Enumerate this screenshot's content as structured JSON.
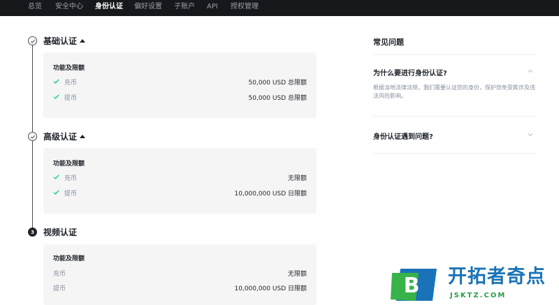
{
  "nav": {
    "items": [
      {
        "label": "总览"
      },
      {
        "label": "安全中心"
      },
      {
        "label": "身份认证"
      },
      {
        "label": "偏好设置"
      },
      {
        "label": "子账户"
      },
      {
        "label": "API"
      },
      {
        "label": "授权管理"
      }
    ],
    "active_index": 2
  },
  "steps": [
    {
      "title": "基础认证",
      "status": "done",
      "expanded": true,
      "card_heading": "功能及限额",
      "rows": [
        {
          "label": "充币",
          "value": "50,000 USD 总限额",
          "checked": true
        },
        {
          "label": "提币",
          "value": "50,000 USD 总限额",
          "checked": true
        }
      ]
    },
    {
      "title": "高级认证",
      "status": "done",
      "expanded": true,
      "card_heading": "功能及限额",
      "rows": [
        {
          "label": "充币",
          "value": "无限额",
          "checked": true
        },
        {
          "label": "提币",
          "value": "10,000,000 USD 日限额",
          "checked": true
        }
      ]
    },
    {
      "title": "视频认证",
      "status": "pending",
      "number": "3",
      "card_heading": "功能及限额",
      "rows": [
        {
          "label": "充币",
          "value": "无限额",
          "checked": false
        },
        {
          "label": "提币",
          "value": "10,000,000 USD 日限额",
          "checked": false
        }
      ]
    }
  ],
  "faq": {
    "title": "常见问题",
    "items": [
      {
        "question": "为什么要进行身份认证?",
        "expanded": true,
        "answer": "根据当地法律法规，我们需要认证您的身份，保护您免受欺诈及违法风险影响。"
      },
      {
        "question": "身份认证遇到问题?",
        "expanded": false
      }
    ]
  },
  "watermark": {
    "logo_letter": "B",
    "name": "开拓者奇点",
    "url": "JSKTZ.COM"
  },
  "colors": {
    "nav_bg": "#16181c",
    "check_green": "#0ecb81",
    "card_bg": "#f5f5f5",
    "muted_text": "#848e9c",
    "watermark_blue": "#1a73b8",
    "watermark_green": "#2a9d4a"
  }
}
